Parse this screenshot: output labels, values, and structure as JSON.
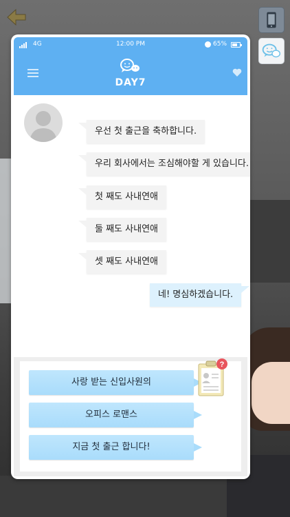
{
  "status_bar": {
    "network": "4G",
    "time": "12:00  PM",
    "battery": "65%"
  },
  "header": {
    "title": "DAY7"
  },
  "messages": [
    {
      "from": "other",
      "text": "우선 첫 출근을 축하합니다."
    },
    {
      "from": "other",
      "text": "우리 회사에서는 조심해야할 게 있습니다."
    },
    {
      "from": "other",
      "text": "첫 째도 사내연애"
    },
    {
      "from": "other",
      "text": "둘 째도 사내연애"
    },
    {
      "from": "other",
      "text": "셋 째도 사내연애"
    },
    {
      "from": "me",
      "text": "네! 명심하겠습니다."
    }
  ],
  "choices": [
    {
      "label": "사랑 받는 신입사원의"
    },
    {
      "label": "오피스 로맨스"
    },
    {
      "label": "지금 첫 출근 합니다!"
    }
  ],
  "colors": {
    "accent": "#5eb0f2",
    "bubble_in": "#f3f3f3",
    "bubble_out": "#ddf1fd",
    "choice": "#a9dcfb",
    "badge": "#e8555d"
  },
  "icons": [
    "back-arrow-icon",
    "phone-icon",
    "chat-icon",
    "menu-icon",
    "chat-logo-icon",
    "heart-icon",
    "profile-card-icon",
    "question-badge-icon"
  ]
}
